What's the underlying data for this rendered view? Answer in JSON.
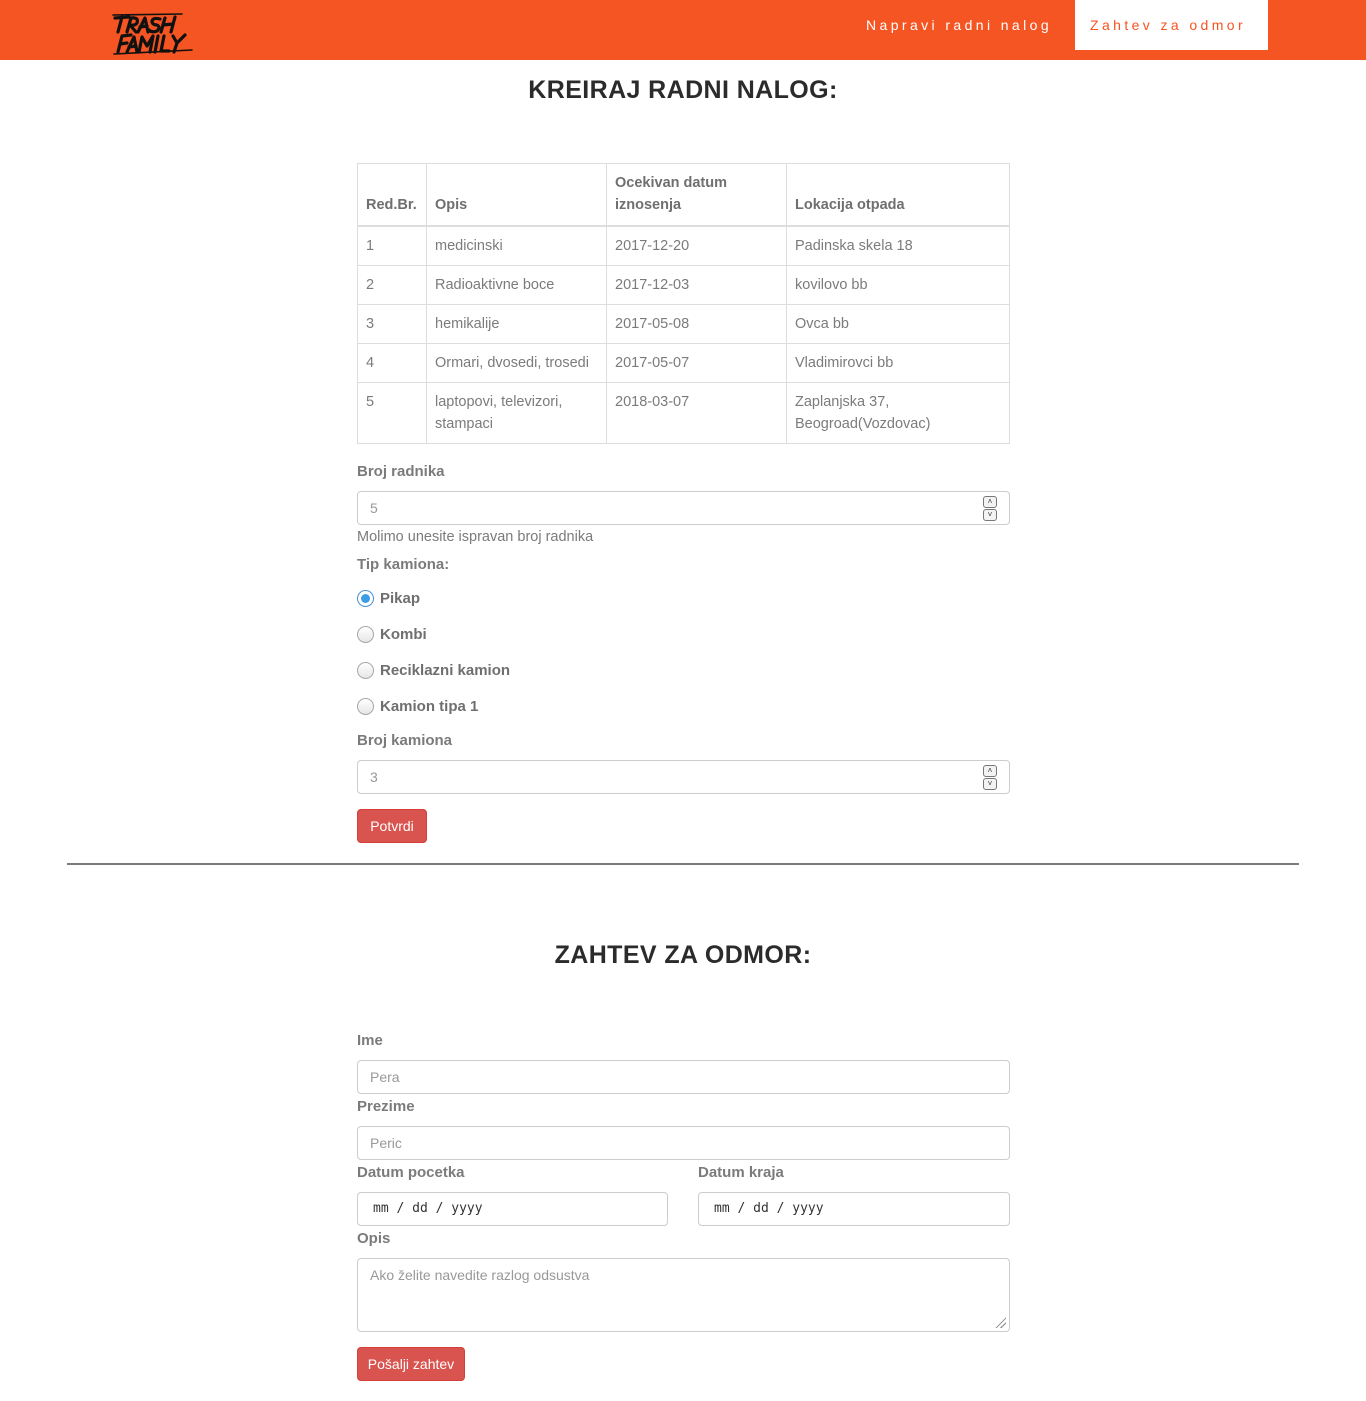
{
  "header": {
    "logo_text": "TRASH FAMILY",
    "nav": [
      {
        "label": "Napravi radni nalog"
      },
      {
        "label": "Zahtev za odmor"
      }
    ]
  },
  "work_order": {
    "title": "KREIRAJ RADNI NALOG:",
    "table": {
      "headers": [
        "Red.Br.",
        "Opis",
        "Ocekivan datum iznosenja",
        "Lokacija otpada"
      ],
      "rows": [
        [
          "1",
          "medicinski",
          "2017-12-20",
          "Padinska skela 18"
        ],
        [
          "2",
          "Radioaktivne boce",
          "2017-12-03",
          "kovilovo bb"
        ],
        [
          "3",
          "hemikalije",
          "2017-05-08",
          "Ovca bb"
        ],
        [
          "4",
          "Ormari, dvosedi, trosedi",
          "2017-05-07",
          "Vladimirovci bb"
        ],
        [
          "5",
          "laptopovi, televizori, stampaci",
          "2018-03-07",
          "Zaplanjska 37, Beogroad(Vozdovac)"
        ]
      ]
    },
    "workers_label": "Broj radnika",
    "workers_placeholder": "5",
    "workers_help": "Molimo unesite ispravan broj radnika",
    "truck_type_label": "Tip kamiona:",
    "truck_types": [
      {
        "label": "Pikap",
        "checked": true
      },
      {
        "label": "Kombi",
        "checked": false
      },
      {
        "label": "Reciklazni kamion",
        "checked": false
      },
      {
        "label": "Kamion tipa 1",
        "checked": false
      }
    ],
    "trucks_label": "Broj kamiona",
    "trucks_placeholder": "3",
    "submit_label": "Potvrdi"
  },
  "vacation": {
    "title": "ZAHTEV ZA ODMOR:",
    "first_name_label": "Ime",
    "first_name_placeholder": "Pera",
    "last_name_label": "Prezime",
    "last_name_placeholder": "Peric",
    "start_date_label": "Datum pocetka",
    "end_date_label": "Datum kraja",
    "date_placeholder": "mm / dd / yyyy",
    "description_label": "Opis",
    "description_placeholder": "Ako želite navedite razlog odsustva",
    "submit_label": "Pošalji zahtev"
  },
  "colors": {
    "brand": "#f55522",
    "button": "#d9534f",
    "radio_checked": "#3c9de4"
  }
}
